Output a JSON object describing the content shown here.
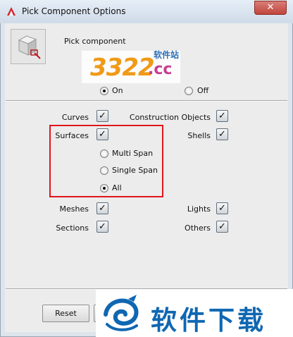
{
  "window": {
    "title": "Pick Component Options",
    "close_symbol": "✕"
  },
  "pick": {
    "label": "Pick component",
    "on_label": "On",
    "off_label": "Off",
    "selected": "On"
  },
  "components": {
    "curves": "Curves",
    "construction_objects": "Construction Objects",
    "surfaces": "Surfaces",
    "shells": "Shells",
    "meshes": "Meshes",
    "lights": "Lights",
    "sections": "Sections",
    "others": "Others",
    "surface_options": {
      "multi_span": "Multi Span",
      "single_span": "Single Span",
      "all": "All",
      "selected": "All"
    }
  },
  "footer": {
    "reset_label": "Reset"
  },
  "watermark": {
    "top_number": "3322",
    "top_domain": ".cc",
    "top_cn": "软件站",
    "bottom_text": "软件下载"
  },
  "colors": {
    "highlight": "#e0161c",
    "titlebar": "#dbe5f0",
    "close": "#c0453b"
  },
  "icons": {
    "app": "autodesk-a-icon",
    "pick": "cube-pick-icon",
    "check": "checkmark"
  }
}
